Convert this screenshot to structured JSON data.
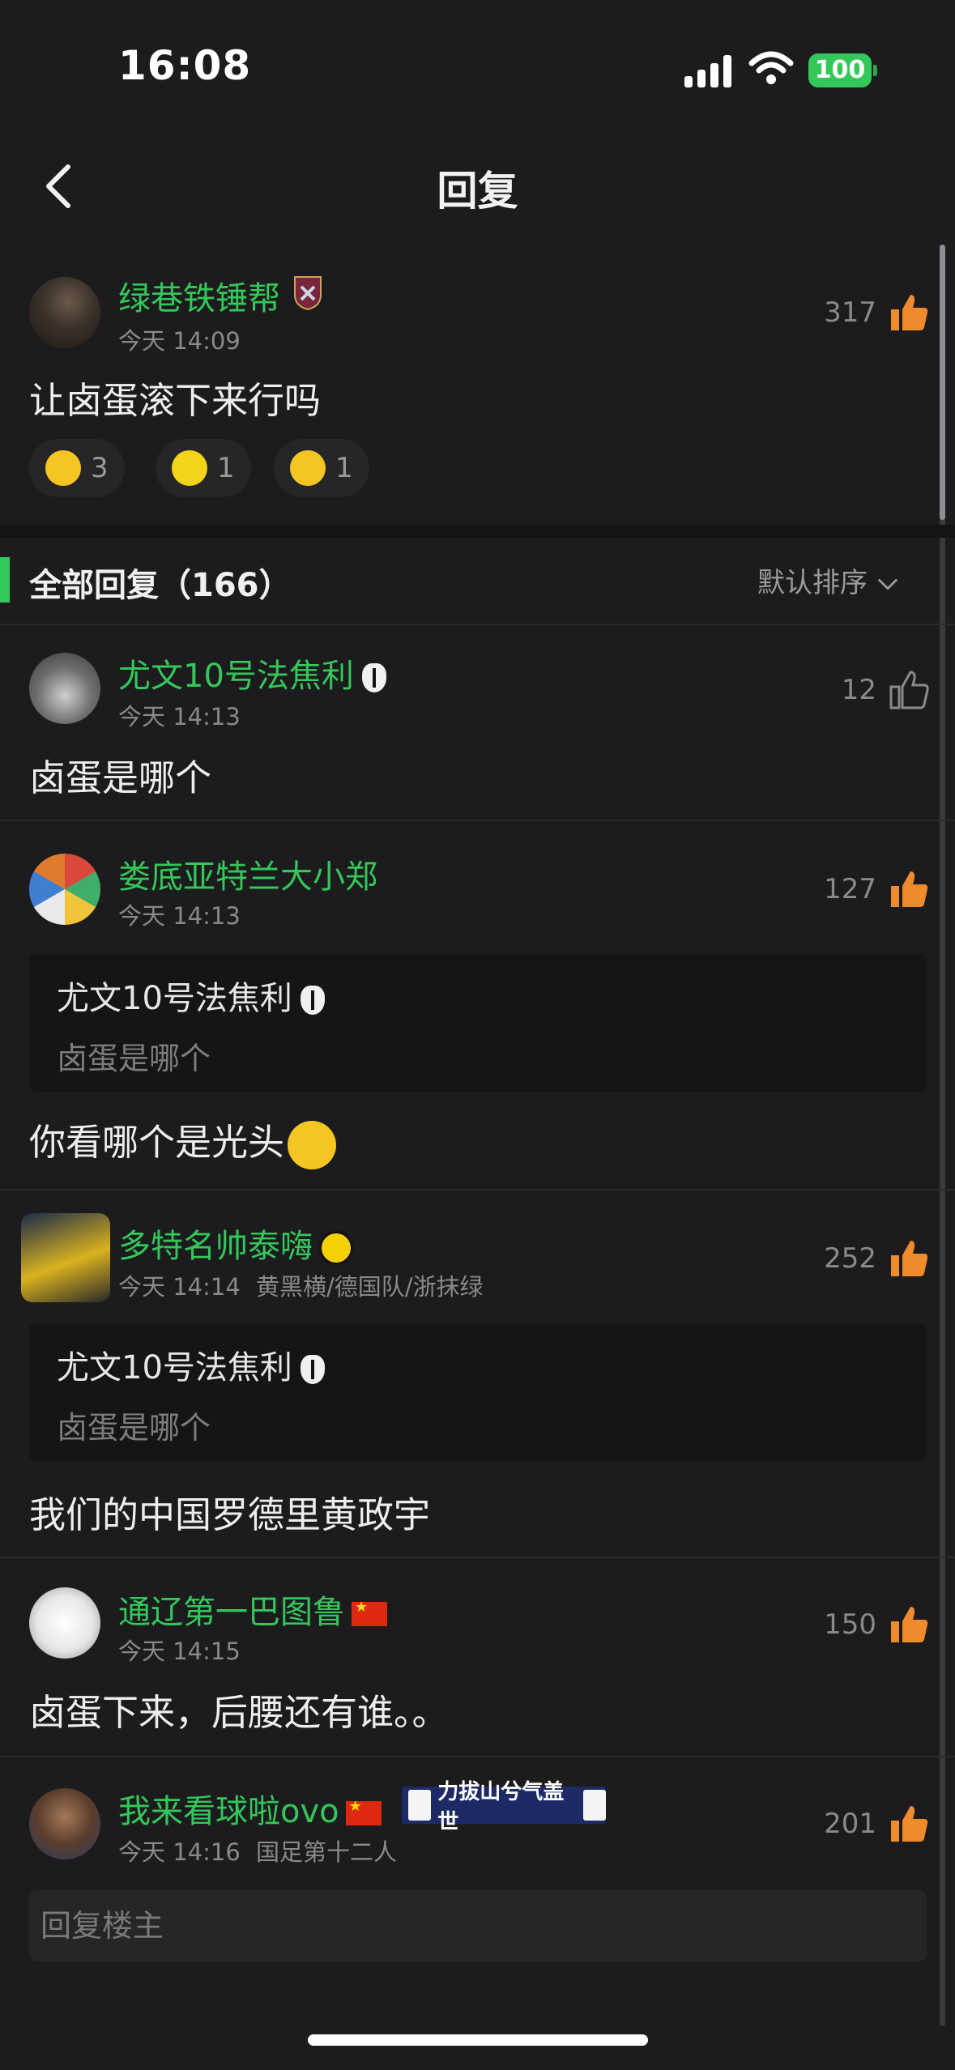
{
  "status_bar": {
    "time": "16:08",
    "battery": "100"
  },
  "nav": {
    "title": "回复"
  },
  "main_comment": {
    "username": "绿巷铁锤帮",
    "time": "今天 14:09",
    "likes": "317",
    "text": "让卤蛋滚下来行吗",
    "reactions": [
      {
        "icon": "thinking-emoji-icon",
        "count": "3"
      },
      {
        "icon": "lemon-emoji-icon",
        "count": "1"
      },
      {
        "icon": "smirk-emoji-icon",
        "count": "1"
      }
    ]
  },
  "section": {
    "title": "全部回复（166）",
    "sort_label": "默认排序"
  },
  "replies": [
    {
      "username": "尤文10号法焦利",
      "time": "今天 14:13",
      "likes": "12",
      "text": "卤蛋是哪个"
    },
    {
      "username": "娄底亚特兰大小郑",
      "time": "今天 14:13",
      "likes": "127",
      "quote_name": "尤文10号法焦利",
      "quote_text": "卤蛋是哪个",
      "text": "你看哪个是光头"
    },
    {
      "username": "多特名帅泰嗨",
      "time": "今天 14:14",
      "tags": "黄黑横/德国队/浙抹绿",
      "likes": "252",
      "quote_name": "尤文10号法焦利",
      "quote_text": "卤蛋是哪个",
      "text": "我们的中国罗德里黄政宇"
    },
    {
      "username": "通辽第一巴图鲁",
      "time": "今天 14:15",
      "likes": "150",
      "text": "卤蛋下来，后腰还有谁。。"
    },
    {
      "username": "我来看球啦ovo",
      "time": "今天 14:16",
      "tags": "国足第十二人",
      "likes": "201",
      "badge_text": "力拔山兮气盖世"
    }
  ],
  "reply_input": {
    "placeholder": "回复楼主"
  },
  "colors": {
    "background": "#1c1c1e",
    "username": "#34c759",
    "like_icon": "#ef8b2c"
  }
}
